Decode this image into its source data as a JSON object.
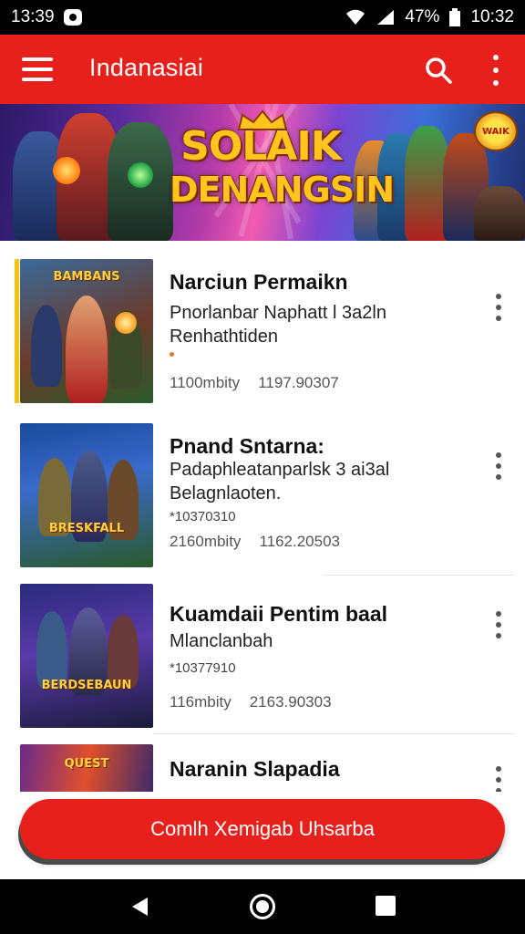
{
  "status_bar": {
    "time": "13:39",
    "battery_text": "47%",
    "right_time": "10:32"
  },
  "app_bar": {
    "title": "Indanasiai"
  },
  "banner": {
    "logo_line1": "SOLAIK",
    "logo_line2": "DENANGSIN",
    "badge": "WAIK"
  },
  "items": [
    {
      "title": "Narciun Permaikn",
      "subtitle_lines": [
        "Pnorlanbar Naphatt l 3a2ln",
        "Renhathtiden"
      ],
      "code": "",
      "meta1": "1100mbity",
      "meta2": "1197.90307",
      "thumb_text": "BAMBANS"
    },
    {
      "title": "Pnand Sntarna:",
      "subtitle_lines": [
        "Padaphleatanparlsk 3 ai3al",
        "Belagnlaoten."
      ],
      "code": "*10370310",
      "meta1": "2160mbity",
      "meta2": "1162.20503",
      "thumb_text": "BRESKFALL"
    },
    {
      "title": "Kuamdaii Pentim baal",
      "subtitle_lines": [
        "Mlanclanbah"
      ],
      "code": "*10377910",
      "meta1": "116mbity",
      "meta2": "2163.90303",
      "thumb_text": "BERDSEBAUN"
    },
    {
      "title": "Naranin Slapadia",
      "subtitle_lines": [],
      "code": "",
      "meta1": "",
      "meta2": "",
      "thumb_text": "QUEST"
    }
  ],
  "cta": {
    "label": "Comlh Xemigab Uhsarba"
  },
  "colors": {
    "primary": "#e8201c",
    "accent": "#f2c20e"
  }
}
